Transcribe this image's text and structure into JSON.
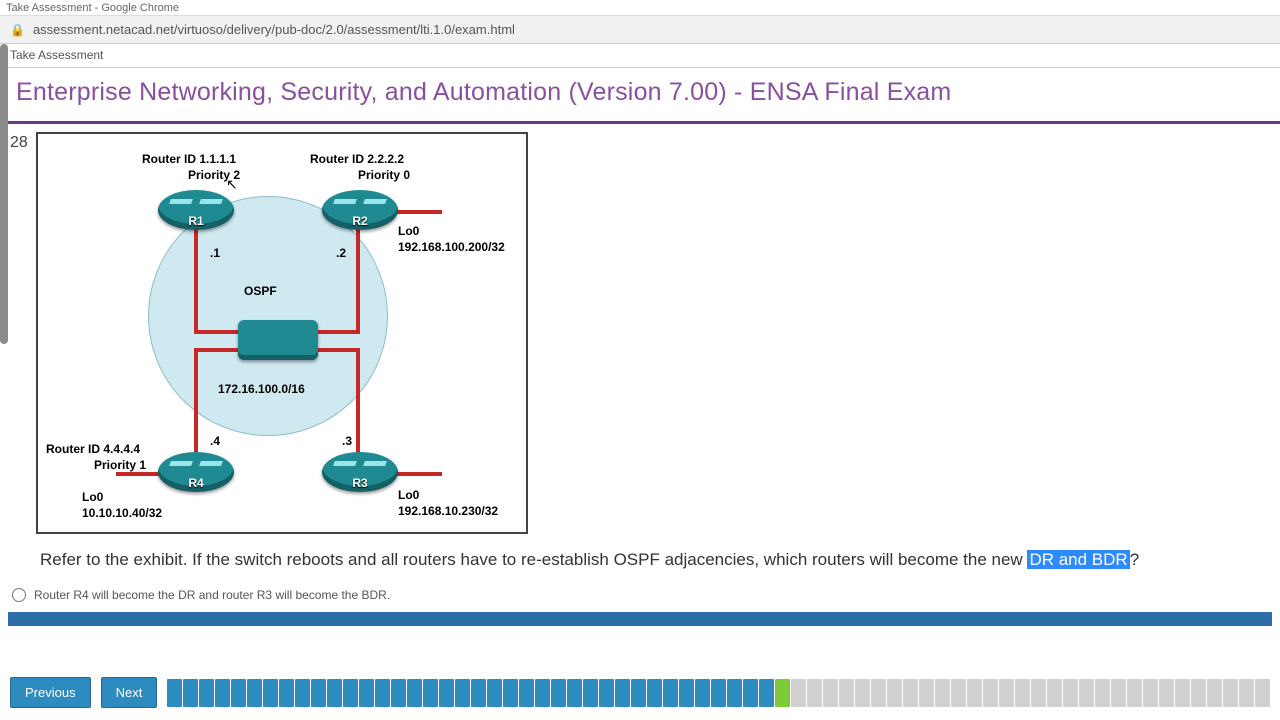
{
  "browser": {
    "tab_title": "Take Assessment - Google Chrome",
    "url": "assessment.netacad.net/virtuoso/delivery/pub-doc/2.0/assessment/lti.1.0/exam.html",
    "lock_icon": "🔒"
  },
  "app_tab": "Take Assessment",
  "page_title": "Enterprise Networking, Security, and Automation (Version 7.00) - ENSA Final Exam",
  "question_number": "28",
  "diagram": {
    "r1": {
      "id_line": "Router ID 1.1.1.1",
      "priority": "Priority 2",
      "label": "R1",
      "host": ".1"
    },
    "r2": {
      "id_line": "Router ID 2.2.2.2",
      "priority": "Priority 0",
      "label": "R2",
      "host": ".2",
      "lo_name": "Lo0",
      "lo_addr": "192.168.100.200/32"
    },
    "r3": {
      "label": "R3",
      "host": ".3",
      "lo_name": "Lo0",
      "lo_addr": "192.168.10.230/32"
    },
    "r4": {
      "id_line": "Router ID 4.4.4.4",
      "priority": "Priority 1",
      "label": "R4",
      "host": ".4",
      "lo_name": "Lo0",
      "lo_addr": "10.10.10.40/32"
    },
    "area_label": "OSPF",
    "network": "172.16.100.0/16"
  },
  "question_text_pre": "Refer to the exhibit. If the switch reboots and all routers have to re-establish OSPF adjacencies, which routers will become the new ",
  "question_highlight": "DR and BDR",
  "question_text_post": "?",
  "answers": {
    "a1": "Router R4 will become the DR and router R3 will become the BDR."
  },
  "footer": {
    "prev": "Previous",
    "next": "Next",
    "progress": {
      "done": 38,
      "current": 1,
      "remaining": 30
    }
  }
}
